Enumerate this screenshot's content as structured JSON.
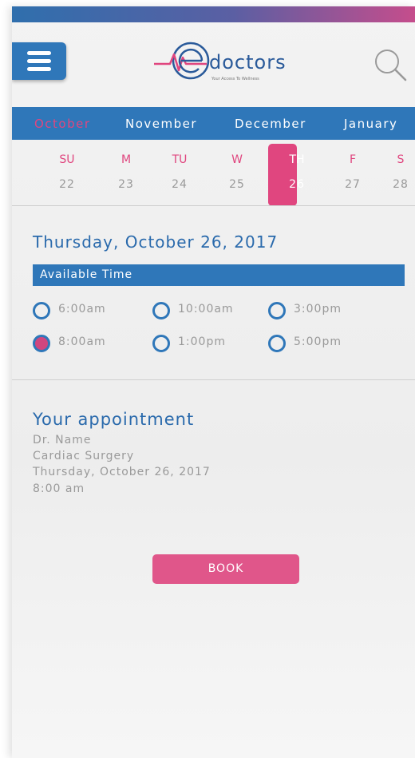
{
  "header": {
    "logo_text": "doctors",
    "logo_tagline": "Your Access To Wellness"
  },
  "months": [
    "October",
    "November",
    "December",
    "January"
  ],
  "active_month": "October",
  "days": [
    {
      "name": "SU",
      "num": "22"
    },
    {
      "name": "M",
      "num": "23"
    },
    {
      "name": "TU",
      "num": "24"
    },
    {
      "name": "W",
      "num": "25"
    },
    {
      "name": "TH",
      "num": "26"
    },
    {
      "name": "F",
      "num": "27"
    },
    {
      "name": "S",
      "num": "28"
    }
  ],
  "selected_day": "26",
  "date_title": "Thursday, October 26, 2017",
  "available_time_label": "Available Time",
  "time_slots": [
    {
      "label": "6:00am",
      "checked": false
    },
    {
      "label": "10:00am",
      "checked": false
    },
    {
      "label": "3:00pm",
      "checked": false
    },
    {
      "label": "8:00am",
      "checked": true
    },
    {
      "label": "1:00pm",
      "checked": false
    },
    {
      "label": "5:00pm",
      "checked": false
    }
  ],
  "appointment": {
    "title": "Your appointment",
    "doctor": "Dr. Name",
    "specialty": "Cardiac Surgery",
    "date": "Thursday, October 26, 2017",
    "time": "8:00 am"
  },
  "book_label": "BOOK",
  "colors": {
    "primary_blue": "#2f77b9",
    "accent_pink": "#e0467f",
    "text_gray": "#999999"
  }
}
